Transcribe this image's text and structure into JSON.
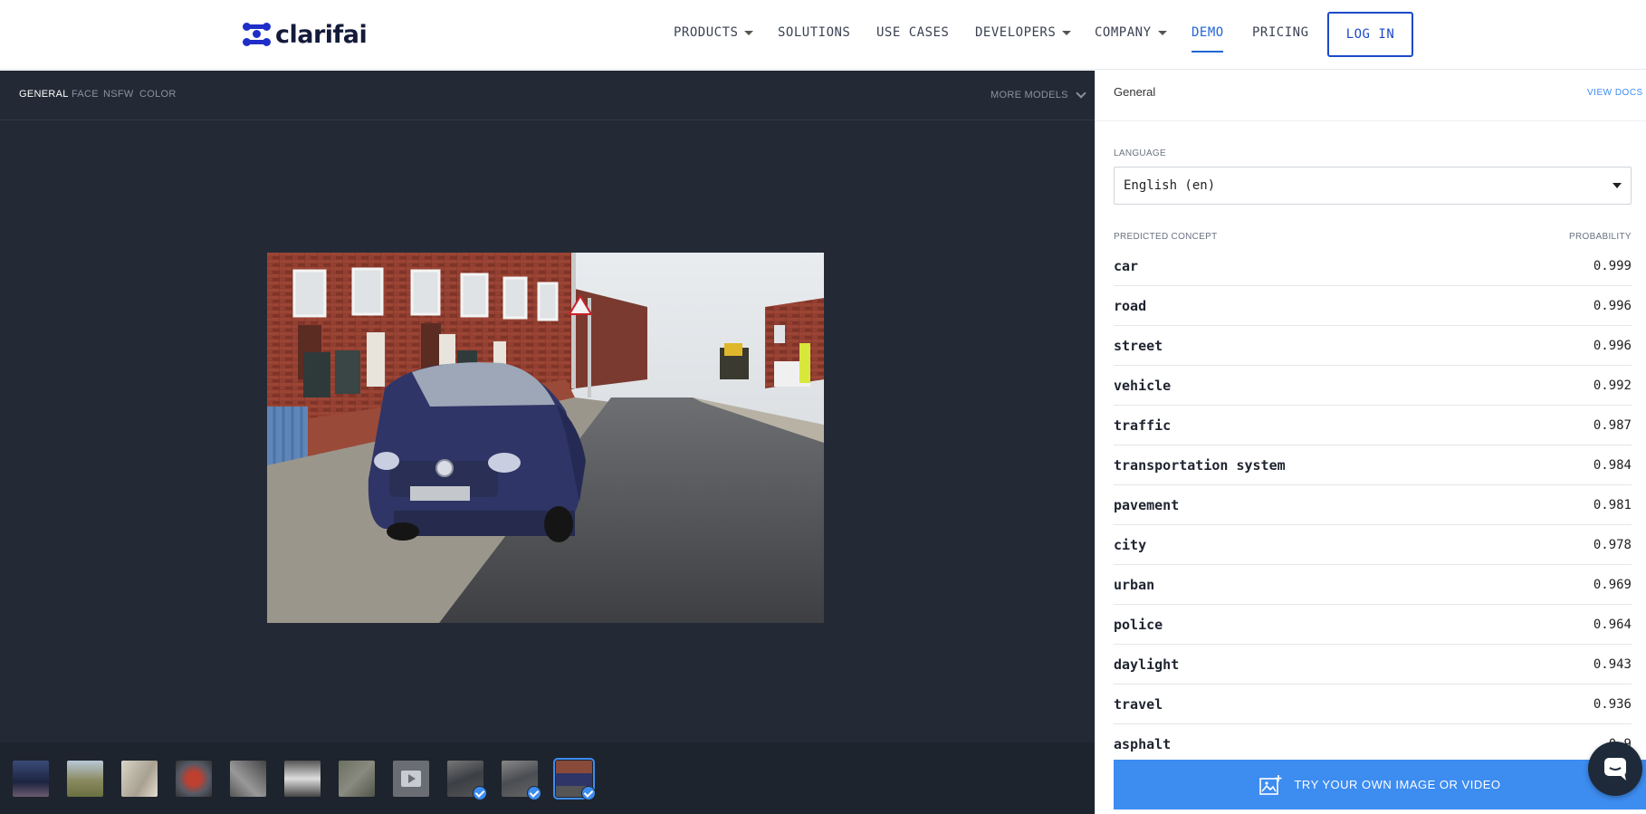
{
  "header": {
    "logo_text": "clarifai",
    "nav": [
      {
        "label": "PRODUCTS",
        "has_caret": true
      },
      {
        "label": "SOLUTIONS",
        "has_caret": false
      },
      {
        "label": "USE CASES",
        "has_caret": false
      },
      {
        "label": "DEVELOPERS",
        "has_caret": true
      },
      {
        "label": "COMPANY",
        "has_caret": true
      },
      {
        "label": "DEMO",
        "has_caret": false,
        "active": true
      },
      {
        "label": "PRICING",
        "has_caret": false
      }
    ],
    "login_label": "LOG IN"
  },
  "models": {
    "tabs": [
      "GENERAL",
      "FACE",
      "NSFW",
      "COLOR"
    ],
    "active": "GENERAL",
    "more_label": "MORE MODELS"
  },
  "panel": {
    "title": "General",
    "view_docs": "VIEW DOCS",
    "language_label": "LANGUAGE",
    "language_value": "English (en)",
    "concept_header": "PREDICTED CONCEPT",
    "probability_header": "PROBABILITY",
    "concepts": [
      {
        "name": "car",
        "prob": "0.999"
      },
      {
        "name": "road",
        "prob": "0.996"
      },
      {
        "name": "street",
        "prob": "0.996"
      },
      {
        "name": "vehicle",
        "prob": "0.992"
      },
      {
        "name": "traffic",
        "prob": "0.987"
      },
      {
        "name": "transportation system",
        "prob": "0.984"
      },
      {
        "name": "pavement",
        "prob": "0.981"
      },
      {
        "name": "city",
        "prob": "0.978"
      },
      {
        "name": "urban",
        "prob": "0.969"
      },
      {
        "name": "police",
        "prob": "0.964"
      },
      {
        "name": "daylight",
        "prob": "0.943"
      },
      {
        "name": "travel",
        "prob": "0.936"
      },
      {
        "name": "asphalt",
        "prob": "0.9"
      }
    ],
    "try_label": "TRY YOUR OWN IMAGE OR VIDEO"
  },
  "icons": {
    "logo": "clarifai-logo-icon",
    "upload": "image-upload-icon",
    "chat": "chat-icon",
    "chevron": "chevron-down-icon",
    "check": "check-icon",
    "play": "play-icon"
  },
  "colors": {
    "brand": "#1f2ec8",
    "accent": "#3d8cf0",
    "dark_bg": "#232a35",
    "demo_active": "#2266d4"
  }
}
